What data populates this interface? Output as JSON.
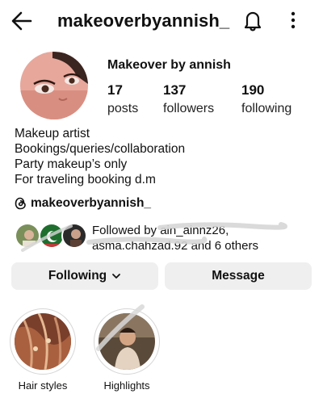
{
  "header": {
    "username": "makeoverbyannish_",
    "back_icon": "arrow-left-icon",
    "bell_icon": "bell-icon",
    "menu_icon": "more-vertical-icon"
  },
  "profile": {
    "display_name": "Makeover by annish",
    "stats": [
      {
        "value": "17",
        "label": "posts"
      },
      {
        "value": "137",
        "label": "followers"
      },
      {
        "value": "190",
        "label": "following"
      }
    ],
    "bio": [
      "Makeup artist",
      "Bookings/queries/collaboration",
      "Party makeup’s only",
      "For traveling booking d.m"
    ],
    "threads_icon": "threads-icon",
    "threads_handle": "makeoverbyannish_"
  },
  "followed_by": {
    "line1": "Followed by ain_ainnz26,",
    "line2": "asma.chahzad.92 and 6 others"
  },
  "actions": {
    "following_label": "Following",
    "chevron_icon": "chevron-down-icon",
    "message_label": "Message"
  },
  "highlights": [
    {
      "label": "Hair styles"
    },
    {
      "label": "Highlights"
    }
  ]
}
